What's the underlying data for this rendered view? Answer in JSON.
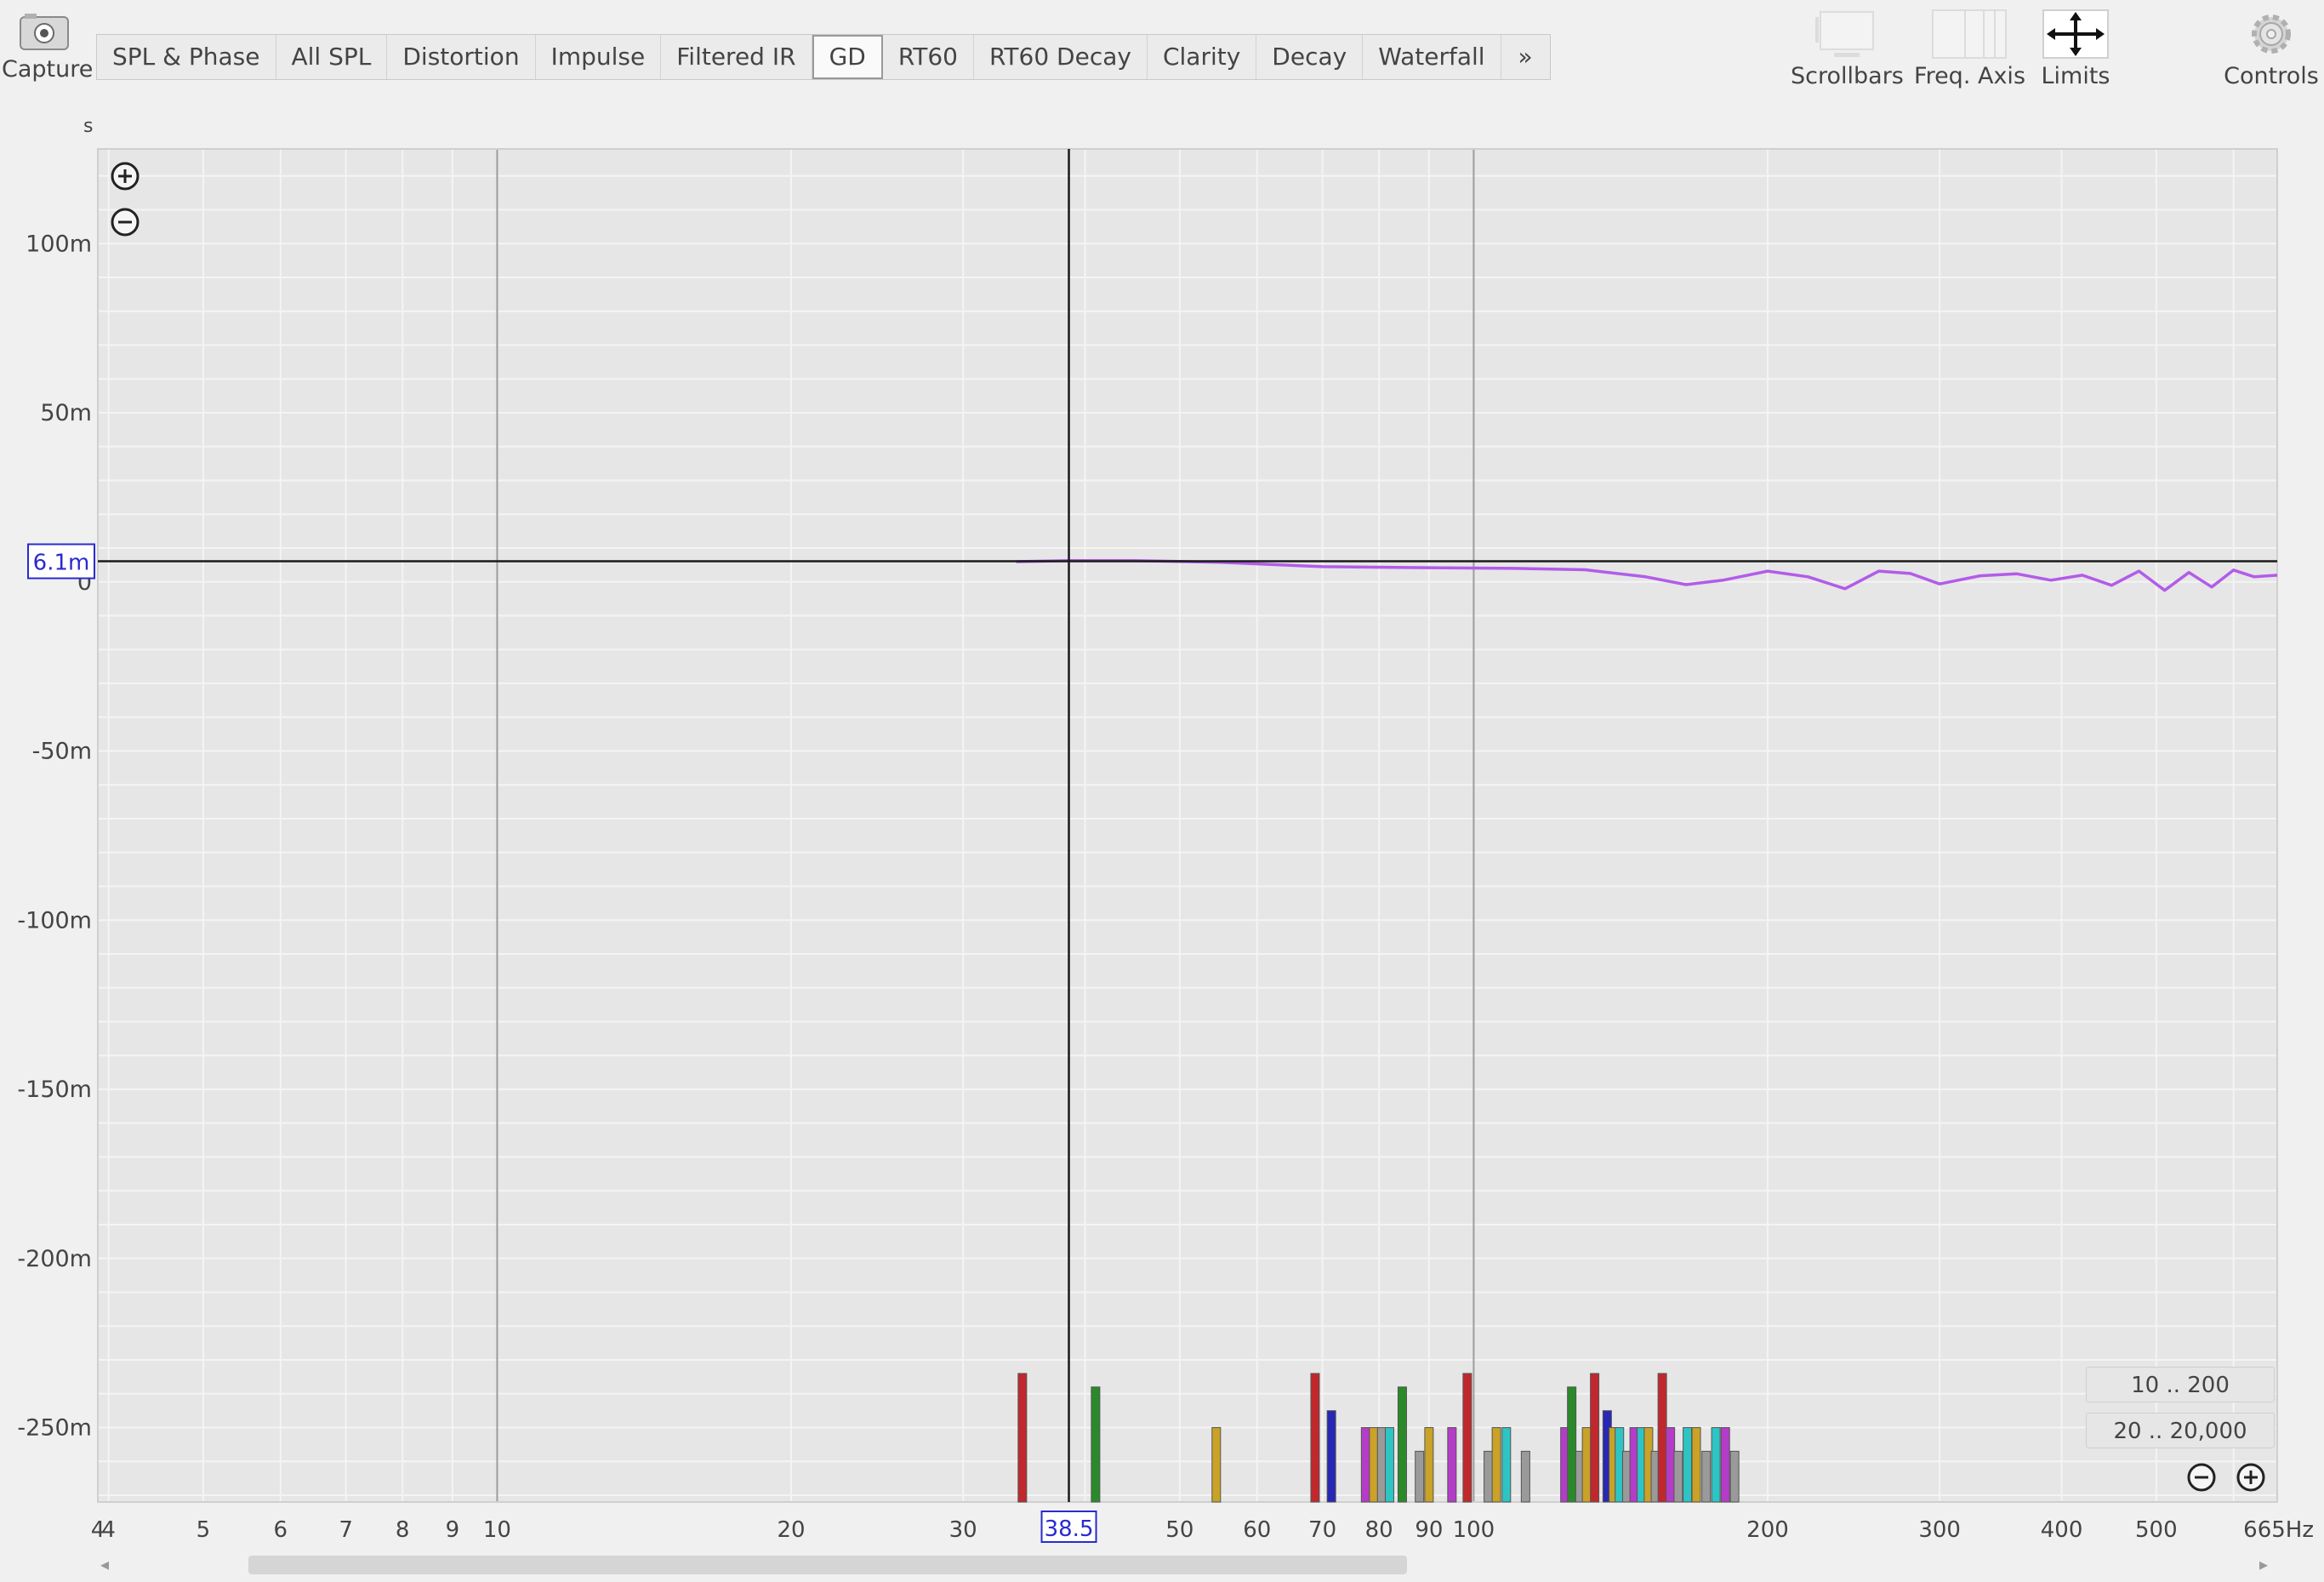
{
  "toolbar": {
    "capture_label": "Capture",
    "tabs": [
      "SPL & Phase",
      "All SPL",
      "Distortion",
      "Impulse",
      "Filtered IR",
      "GD",
      "RT60",
      "RT60 Decay",
      "Clarity",
      "Decay",
      "Waterfall"
    ],
    "active_tab": "GD",
    "more_label": "»",
    "right_tools": {
      "scrollbars": "Scrollbars",
      "freq_axis": "Freq. Axis",
      "limits": "Limits",
      "controls": "Controls"
    }
  },
  "plot": {
    "y_unit": "s",
    "x_unit": "Hz",
    "cursor_x_label": "38.5",
    "cursor_y_label": "6.1m",
    "range_buttons": [
      "10 .. 200",
      "20 .. 20,000"
    ]
  },
  "chart_data": {
    "type": "line",
    "x_scale": "log",
    "xlim": [
      3.9,
      665
    ],
    "ylim": [
      -272,
      128
    ],
    "y_ticks": [
      {
        "v": 100,
        "label": "100m"
      },
      {
        "v": 50,
        "label": "50m"
      },
      {
        "v": 0,
        "label": "0"
      },
      {
        "v": -50,
        "label": "-50m"
      },
      {
        "v": -100,
        "label": "-100m"
      },
      {
        "v": -150,
        "label": "-150m"
      },
      {
        "v": -200,
        "label": "-200m"
      },
      {
        "v": -250,
        "label": "-250m"
      }
    ],
    "x_ticks": [
      {
        "v": 3.9,
        "label": "4"
      },
      {
        "v": 4,
        "label": "4"
      },
      {
        "v": 5,
        "label": "5"
      },
      {
        "v": 6,
        "label": "6"
      },
      {
        "v": 7,
        "label": "7"
      },
      {
        "v": 8,
        "label": "8"
      },
      {
        "v": 9,
        "label": "9"
      },
      {
        "v": 10,
        "label": "10"
      },
      {
        "v": 20,
        "label": "20"
      },
      {
        "v": 30,
        "label": "30"
      },
      {
        "v": 50,
        "label": "50"
      },
      {
        "v": 60,
        "label": "60"
      },
      {
        "v": 70,
        "label": "70"
      },
      {
        "v": 80,
        "label": "80"
      },
      {
        "v": 90,
        "label": "90"
      },
      {
        "v": 100,
        "label": "100"
      },
      {
        "v": 200,
        "label": "200"
      },
      {
        "v": 300,
        "label": "300"
      },
      {
        "v": 400,
        "label": "400"
      },
      {
        "v": 500,
        "label": "500"
      },
      {
        "v": 665,
        "label": "665Hz"
      }
    ],
    "cursor": {
      "x": 38.5,
      "y": 6.1
    },
    "series": [
      {
        "color": "#b25ce8",
        "x": [
          34,
          38.5,
          45,
          55,
          70,
          90,
          110,
          130,
          150,
          165,
          180,
          200,
          220,
          240,
          260,
          280,
          300,
          330,
          360,
          390,
          420,
          450,
          480,
          510,
          540,
          570,
          600,
          630,
          665
        ],
        "y": [
          6.0,
          6.3,
          6.3,
          5.8,
          4.5,
          4.2,
          4.0,
          3.6,
          1.5,
          -0.8,
          0.5,
          3.2,
          1.5,
          -2.0,
          3.2,
          2.5,
          -0.6,
          1.8,
          2.4,
          0.5,
          2.0,
          -1.0,
          3.2,
          -2.5,
          2.8,
          -1.5,
          3.5,
          1.5,
          2.0
        ]
      }
    ],
    "markers": [
      {
        "x": 34.5,
        "top": -234,
        "color": "#c0282d"
      },
      {
        "x": 41.0,
        "top": -238,
        "color": "#2a8a2a"
      },
      {
        "x": 54.5,
        "top": -250,
        "color": "#c9a227"
      },
      {
        "x": 68.8,
        "top": -234,
        "color": "#c0282d"
      },
      {
        "x": 71.5,
        "top": -245,
        "color": "#2828b4"
      },
      {
        "x": 77.5,
        "top": -250,
        "color": "#b43cc8"
      },
      {
        "x": 79.0,
        "top": -250,
        "color": "#c9a227"
      },
      {
        "x": 80.5,
        "top": -250,
        "color": "#9a9a9a"
      },
      {
        "x": 82.0,
        "top": -250,
        "color": "#2ec4c4"
      },
      {
        "x": 84.5,
        "top": -238,
        "color": "#2a8a2a"
      },
      {
        "x": 88.0,
        "top": -257,
        "color": "#9a9a9a"
      },
      {
        "x": 90.0,
        "top": -250,
        "color": "#c9a227"
      },
      {
        "x": 95.0,
        "top": -250,
        "color": "#b43cc8"
      },
      {
        "x": 98.5,
        "top": -234,
        "color": "#c0282d"
      },
      {
        "x": 103.5,
        "top": -257,
        "color": "#9a9a9a"
      },
      {
        "x": 105.5,
        "top": -250,
        "color": "#c9a227"
      },
      {
        "x": 108.0,
        "top": -250,
        "color": "#2ec4c4"
      },
      {
        "x": 113.0,
        "top": -257,
        "color": "#9a9a9a"
      },
      {
        "x": 124.0,
        "top": -250,
        "color": "#b43cc8"
      },
      {
        "x": 126.0,
        "top": -238,
        "color": "#2a8a2a"
      },
      {
        "x": 128.5,
        "top": -257,
        "color": "#9a9a9a"
      },
      {
        "x": 130.5,
        "top": -250,
        "color": "#c9a227"
      },
      {
        "x": 133.0,
        "top": -234,
        "color": "#c0282d"
      },
      {
        "x": 137.0,
        "top": -245,
        "color": "#2828b4"
      },
      {
        "x": 139.0,
        "top": -250,
        "color": "#c9a227"
      },
      {
        "x": 141.0,
        "top": -250,
        "color": "#2ec4c4"
      },
      {
        "x": 143.5,
        "top": -257,
        "color": "#9a9a9a"
      },
      {
        "x": 146.0,
        "top": -250,
        "color": "#b43cc8"
      },
      {
        "x": 148.5,
        "top": -250,
        "color": "#2ec4c4"
      },
      {
        "x": 151.0,
        "top": -250,
        "color": "#c9a227"
      },
      {
        "x": 153.5,
        "top": -257,
        "color": "#9a9a9a"
      },
      {
        "x": 156.0,
        "top": -234,
        "color": "#c0282d"
      },
      {
        "x": 159.0,
        "top": -250,
        "color": "#b43cc8"
      },
      {
        "x": 162.0,
        "top": -257,
        "color": "#9a9a9a"
      },
      {
        "x": 165.5,
        "top": -250,
        "color": "#2ec4c4"
      },
      {
        "x": 169.0,
        "top": -250,
        "color": "#c9a227"
      },
      {
        "x": 173.0,
        "top": -257,
        "color": "#9a9a9a"
      },
      {
        "x": 177.0,
        "top": -250,
        "color": "#2ec4c4"
      },
      {
        "x": 181.0,
        "top": -250,
        "color": "#b43cc8"
      },
      {
        "x": 185.0,
        "top": -257,
        "color": "#9a9a9a"
      }
    ],
    "colors": {
      "background": "#e6e6e6",
      "grid": "#f4f4f4",
      "major_grid": "#9c9c9c",
      "cursor": "#1a1a1a",
      "cursor_label": "#2a2ad0"
    }
  }
}
